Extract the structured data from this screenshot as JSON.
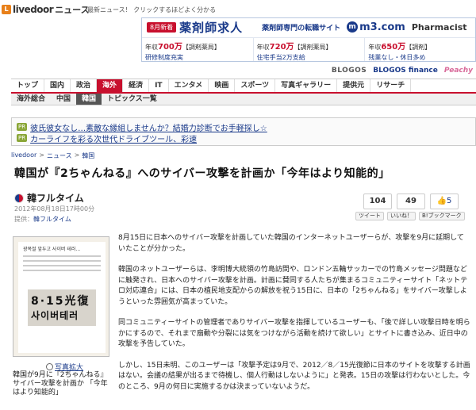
{
  "header": {
    "logo_mark": "L",
    "logo_text": "livedoor",
    "logo_news": "ニュース",
    "tagline": "最新ニュース！ クリックするほどよく分かる"
  },
  "ad": {
    "badge": "8月新着",
    "title": "薬剤師求人",
    "sub": "薬剤師専門の転職サイト",
    "m3_mark": "m",
    "m3_text": "m3.com",
    "pharm": "Pharmacist",
    "cells": [
      {
        "l1_pre": "年収",
        "l1_num": "700万",
        "l1_post": "【調剤薬局】",
        "l2": "研修制度充実"
      },
      {
        "l1_pre": "年収",
        "l1_num": "720万",
        "l1_post": "【調剤薬局】",
        "l2": "住宅手当2万支給"
      },
      {
        "l1_pre": "年収",
        "l1_num": "650万",
        "l1_post": "【調剤】",
        "l2": "残業なし・休日多め"
      }
    ]
  },
  "brands": {
    "blogos": "BLOGOS",
    "finance": "BLOGOS finance",
    "peachy": "Peachy"
  },
  "nav": {
    "items": [
      "トップ",
      "国内",
      "政治",
      "海外",
      "経済",
      "IT",
      "エンタメ",
      "映画",
      "スポーツ",
      "写真ギャラリー",
      "提供元",
      "リサーチ"
    ],
    "active_index": 3
  },
  "subnav": {
    "items": [
      "海外総合",
      "中国",
      "韓国",
      "トピックス一覧"
    ],
    "active_index": 2
  },
  "pr": {
    "tag": "PR",
    "links": [
      "彼氏彼女なし…素敵な縁組しませんか？結婚力診断でお手軽探し☆",
      "カーライフを彩る次世代ドライブツール、彩速"
    ]
  },
  "breadcrumb": [
    "livedoor",
    "ニュース",
    "韓国"
  ],
  "breadcrumb_sep": ">",
  "article": {
    "title": "韓国が『2ちゃんねる』へのサイバー攻撃を計画か「今年はより知能的」",
    "source": "韓フルタイム",
    "date": "2012年08月18日17時00分",
    "provider_label": "提供：",
    "provider": "韓フルタイム"
  },
  "social": {
    "count1": "104",
    "count2": "49",
    "count3": "5",
    "buttons": [
      "ツイート",
      "いいね！",
      "B!ブックマーク"
    ]
  },
  "thumb": {
    "title": "광복절 앞두고 사이버 테러...",
    "big1": "8·15光復",
    "big2": "사이버테러",
    "zoom_label": "写真拡大",
    "caption": "韓国が9月に『2ちゃんねる』サイバー攻撃を計画か 「今年はより知能的」"
  },
  "body": [
    "8月15日に日本へのサイバー攻撃を計画していた韓国のインターネットユーザーらが、攻撃を9月に延期していたことが分かった。",
    "韓国のネットユーザーらは、李明博大統領の竹島訪問や、ロンドン五輪サッカーでの竹島メッセージ問題などに触発され、日本へのサイバー攻撃を計画。計画に賛同する人たちが集まるコミュニティーサイト「ネットテロ対応連合」には、日本の植民地支配からの解放を祝う15日に、日本の「2ちゃんねる」をサイバー攻撃しようといった雰囲気が高まっていた。",
    "同コミュニティーサイトの管理者でありサイバー攻撃を指揮しているユーザーも、「後で詳しい攻撃日時を明らかにするので、それまで扇動や分裂には気をつけながら活動を続けて欲しい」とサイトに書き込み、近日中の攻撃を予告していた。",
    "しかし、15日未明、このユーザーは「攻撃予定は9月で、2012／8／15光復節に日本のサイトを攻撃する計画はない。会議の結果が出るまで待機し、個人行動はしないように」と発表。15日の攻撃は行わないとした。今のところ、9月の何日に実施するかは決まっていないようだ。"
  ]
}
